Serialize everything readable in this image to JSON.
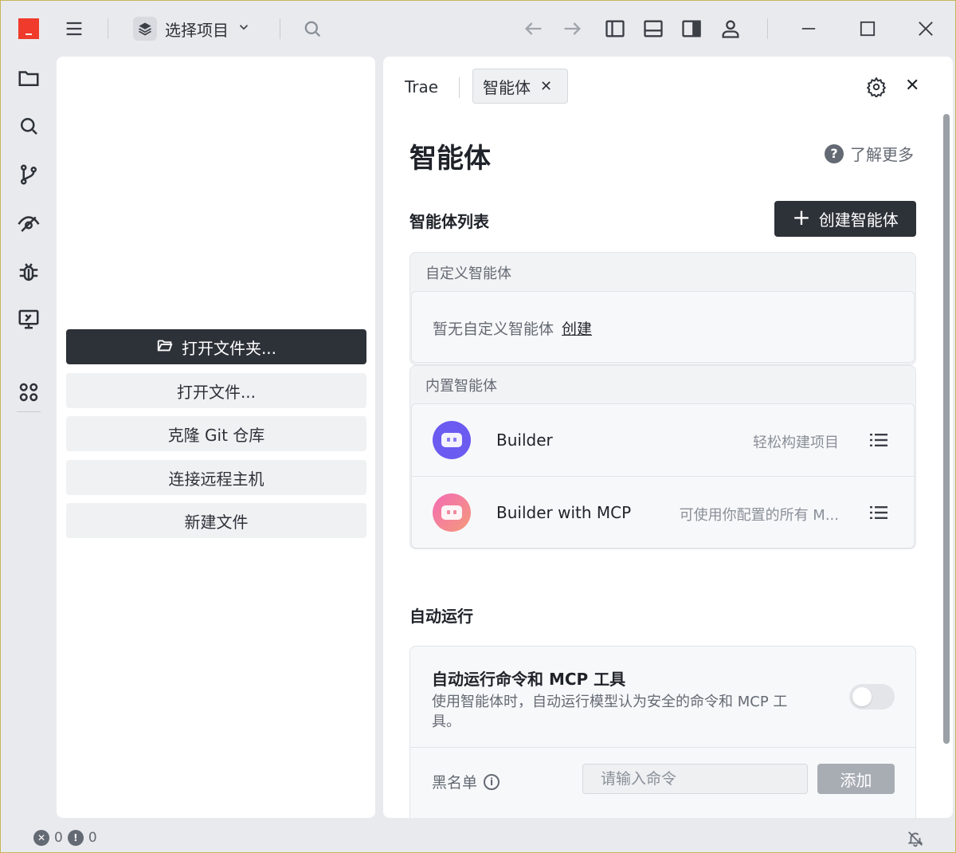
{
  "titlebar": {
    "project_selector": "选择项目"
  },
  "left_panel": {
    "open_folder": "打开文件夹...",
    "open_file": "打开文件...",
    "clone_git": "克隆 Git 仓库",
    "connect_remote": "连接远程主机",
    "new_file": "新建文件"
  },
  "tabs": {
    "trae": "Trae",
    "agent": "智能体"
  },
  "main": {
    "title": "智能体",
    "learn_more": "了解更多",
    "agent_list_heading": "智能体列表",
    "create_agent": "创建智能体",
    "custom_group_label": "自定义智能体",
    "custom_empty_text": "暂无自定义智能体",
    "custom_create_link": "创建",
    "builtin_group_label": "内置智能体",
    "agents": [
      {
        "name": "Builder",
        "desc": "轻松构建项目"
      },
      {
        "name": "Builder with MCP",
        "desc": "可使用你配置的所有 M..."
      }
    ],
    "auto_run_heading": "自动运行",
    "auto_run": {
      "title": "自动运行命令和 MCP 工具",
      "desc": "使用智能体时，自动运行模型认为安全的命令和 MCP 工具。",
      "enabled": false,
      "blacklist_label": "黑名单",
      "blacklist_placeholder": "请输入命令",
      "add_button": "添加"
    }
  },
  "statusbar": {
    "errors": "0",
    "warnings": "0"
  },
  "colors": {
    "primary_dark": "#2d3138",
    "accent_purple": "#6b5bf0",
    "accent_pink": "#f36bb5",
    "logo_red": "#ef3a2c"
  }
}
